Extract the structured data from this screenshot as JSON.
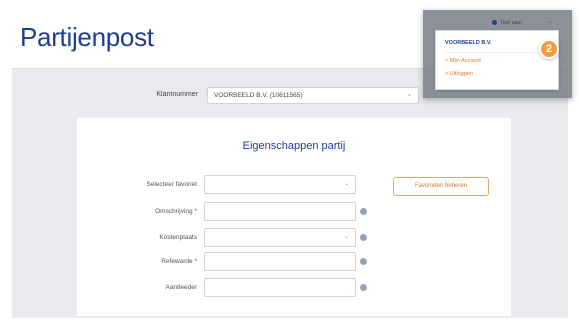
{
  "header": {
    "title": "Partijenpost"
  },
  "klant": {
    "label": "Klantnummer",
    "selected": "VOORBEELD B.V. (10611565)"
  },
  "form": {
    "title": "Eigenschappen partij",
    "fields": [
      {
        "label": "Selecteer favoriet",
        "value": "",
        "type": "select"
      },
      {
        "label": "Omschrijving *",
        "value": "",
        "type": "text"
      },
      {
        "label": "Kostenplaats",
        "value": "",
        "type": "select"
      },
      {
        "label": "Refewarde *",
        "value": "",
        "type": "text"
      },
      {
        "label": "Aantleeder",
        "value": "",
        "type": "text"
      }
    ],
    "favorites_button": "Favorieten beheren"
  },
  "user_menu": {
    "user_name": "Test user",
    "company": "VOORBEELD B.V.",
    "links": [
      "> Mijn Account",
      "> Uitloggen"
    ],
    "badge": "2"
  },
  "colors": {
    "brand_blue": "#1f3e8c",
    "accent_orange": "#e07a2f",
    "badge_orange": "#f39a3b"
  }
}
